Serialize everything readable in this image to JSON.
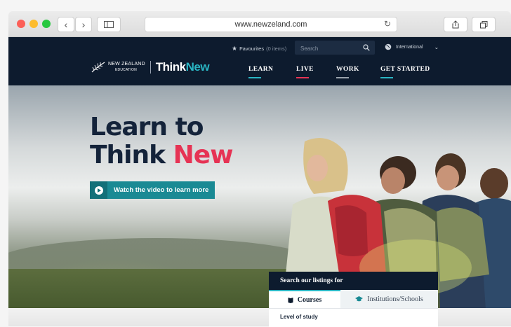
{
  "browser": {
    "url": "www.newzeland.com",
    "back_icon": "chevron-left",
    "forward_icon": "chevron-right",
    "sidebar_icon": "sidebar",
    "reload_icon": "reload",
    "share_icon": "share",
    "tabs_icon": "tabs"
  },
  "header": {
    "favourites_label": "Favourites",
    "favourites_count": "(0 items)",
    "search_placeholder": "Search",
    "region": "International",
    "logo_line1": "NEW ZEALAND",
    "logo_line2": "EDUCATION",
    "brand_think": "Think",
    "brand_new": "New",
    "nav": [
      {
        "label": "LEARN",
        "color": "#2ab6c4"
      },
      {
        "label": "LIVE",
        "color": "#e63354"
      },
      {
        "label": "WORK",
        "color": "#9aa3ad"
      },
      {
        "label": "GET STARTED",
        "color": "#2ab6c4"
      }
    ]
  },
  "hero": {
    "headline_line1": "Learn to",
    "headline_think": "Think",
    "headline_new": "New",
    "cta_label": "Watch the video to learn more"
  },
  "search_panel": {
    "title": "Search our listings for",
    "tab_courses": "Courses",
    "tab_institutions": "Institutions/Schools",
    "level_label": "Level of study"
  },
  "colors": {
    "navy": "#0d1b2e",
    "teal": "#1a8a94",
    "accent_red": "#e63354"
  }
}
